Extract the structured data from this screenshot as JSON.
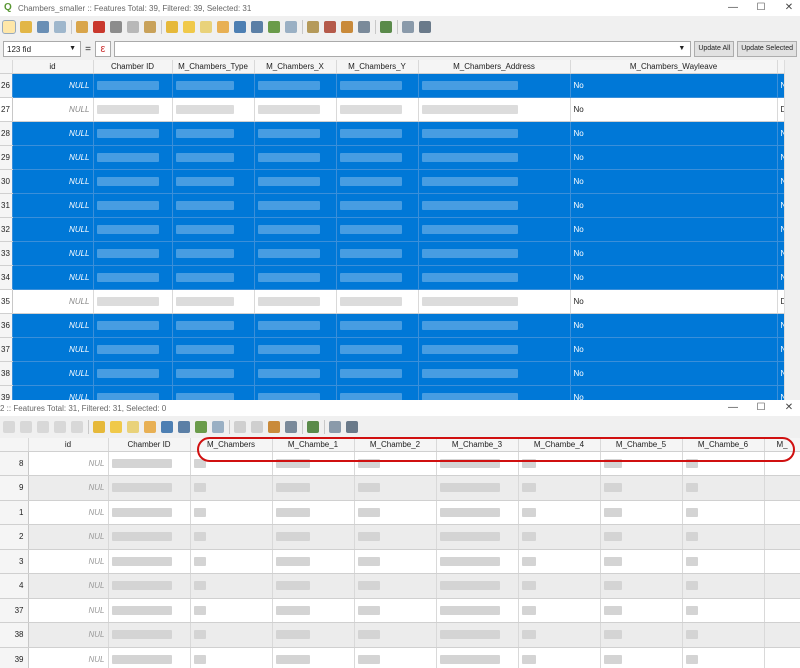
{
  "win1": {
    "title": "Chambers_smaller :: Features Total: 39, Filtered: 39, Selected: 31",
    "minimize": "—",
    "maximize": "☐",
    "close": "✕",
    "field_select": "123 fid",
    "equals": "=",
    "epsilon": "ε",
    "update_all": "Update All",
    "update_selected": "Update Selected",
    "columns": [
      "id",
      "Chamber ID",
      "M_Chambers_Type",
      "M_Chambers_X",
      "M_Chambers_Y",
      "M_Chambers_Address",
      "M_Chambers_Wayleave",
      ""
    ],
    "rows": [
      {
        "n": "26",
        "id": "NULL",
        "wayleave": "No",
        "last": "N",
        "selected": true
      },
      {
        "n": "27",
        "id": "NULL",
        "wayleave": "No",
        "last": "D",
        "selected": false
      },
      {
        "n": "28",
        "id": "NULL",
        "wayleave": "No",
        "last": "N",
        "selected": true
      },
      {
        "n": "29",
        "id": "NULL",
        "wayleave": "No",
        "last": "N",
        "selected": true
      },
      {
        "n": "30",
        "id": "NULL",
        "wayleave": "No",
        "last": "N",
        "selected": true
      },
      {
        "n": "31",
        "id": "NULL",
        "wayleave": "No",
        "last": "N",
        "selected": true
      },
      {
        "n": "32",
        "id": "NULL",
        "wayleave": "No",
        "last": "N",
        "selected": true
      },
      {
        "n": "33",
        "id": "NULL",
        "wayleave": "No",
        "last": "N",
        "selected": true
      },
      {
        "n": "34",
        "id": "NULL",
        "wayleave": "No",
        "last": "N",
        "selected": true
      },
      {
        "n": "35",
        "id": "NULL",
        "wayleave": "No",
        "last": "D",
        "selected": false
      },
      {
        "n": "36",
        "id": "NULL",
        "wayleave": "No",
        "last": "N",
        "selected": true
      },
      {
        "n": "37",
        "id": "NULL",
        "wayleave": "No",
        "last": "N",
        "selected": true
      },
      {
        "n": "38",
        "id": "NULL",
        "wayleave": "No",
        "last": "N",
        "selected": true
      },
      {
        "n": "39",
        "id": "NULL",
        "wayleave": "No",
        "last": "N",
        "selected": true
      }
    ]
  },
  "win2": {
    "title": "2 :: Features Total: 31, Filtered: 31, Selected: 0",
    "minimize": "—",
    "maximize": "☐",
    "close": "✕",
    "columns": [
      "id",
      "Chamber ID",
      "M_Chambers",
      "M_Chambe_1",
      "M_Chambe_2",
      "M_Chambe_3",
      "M_Chambe_4",
      "M_Chambe_5",
      "M_Chambe_6",
      "M_"
    ],
    "rows": [
      {
        "n": "8",
        "id": "NUL"
      },
      {
        "n": "9",
        "id": "NUL"
      },
      {
        "n": "1",
        "id": "NUL"
      },
      {
        "n": "2",
        "id": "NUL"
      },
      {
        "n": "3",
        "id": "NUL"
      },
      {
        "n": "4",
        "id": "NUL"
      },
      {
        "n": "37",
        "id": "NUL"
      },
      {
        "n": "38",
        "id": "NUL"
      },
      {
        "n": "39",
        "id": "NUL"
      }
    ]
  },
  "colors": {
    "selection": "#0078d7",
    "highlight_ring": "#d01010",
    "qgis_green": "#589632"
  }
}
